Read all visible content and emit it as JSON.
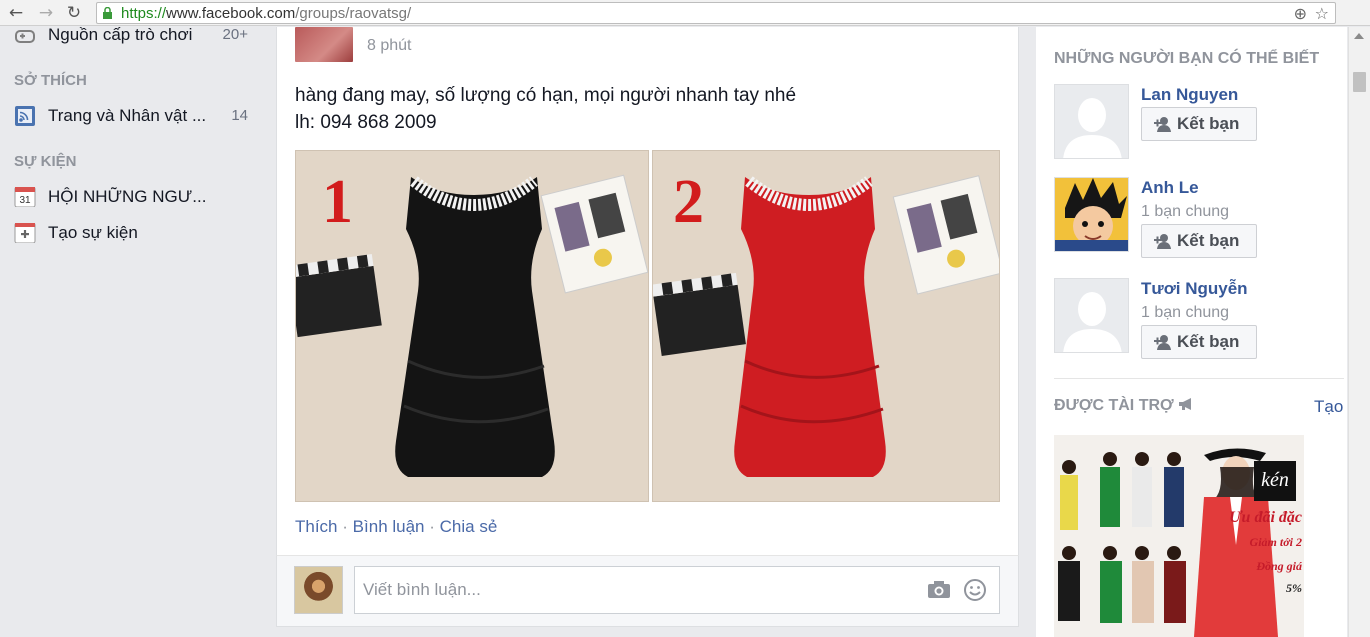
{
  "browser": {
    "url_scheme": "https://",
    "url_host": "www.facebook.com",
    "url_path": "/groups/raovatsg/",
    "icons": [
      "back-icon",
      "forward-icon",
      "reload-icon",
      "lock-icon",
      "zoom-icon",
      "star-icon"
    ]
  },
  "left_nav": {
    "top_item": {
      "label": "Nguồn cấp trò chơi",
      "count": "20+",
      "icon": "game-feed-icon"
    },
    "interests_heading": "SỞ THÍCH",
    "interests": [
      {
        "label": "Trang và Nhân vật ...",
        "count": "14",
        "icon": "rss-pages-icon"
      }
    ],
    "events_heading": "SỰ KIỆN",
    "events": [
      {
        "label": "HỘI NHỮNG NGƯ...",
        "icon": "calendar-icon",
        "calendar_day": "31"
      },
      {
        "label": "Tạo sự kiện",
        "icon": "create-event-icon"
      }
    ]
  },
  "post": {
    "time": "8 phút",
    "text_line1": "hàng đang may, số lượng có hạn, mọi người nhanh tay nhé",
    "text_line2": "lh: 094 868 2009",
    "photos": [
      {
        "label": "1",
        "dress_color": "#141414"
      },
      {
        "label": "2",
        "dress_color": "#cf1d22"
      }
    ],
    "actions": {
      "like": "Thích",
      "comment": "Bình luận",
      "share": "Chia sẻ",
      "separator": "·"
    }
  },
  "comment_box": {
    "placeholder": "Viết bình luận..."
  },
  "right": {
    "pymk_heading": "NHỮNG NGƯỜI BẠN CÓ THỂ BIẾT",
    "add_friend_label": "Kết bạn",
    "friends": [
      {
        "name": "Lan Nguyen",
        "mutual": ""
      },
      {
        "name": "Anh Le",
        "mutual": "1 bạn chung"
      },
      {
        "name": "Tươi Nguyễn",
        "mutual": "1 bạn chung"
      }
    ],
    "sponsored_heading": "ĐƯỢC TÀI TRỢ",
    "create_ad_link": "Tạo",
    "ad": {
      "brand": "kén",
      "text1": "Ưu đãi đặc",
      "text2": "Giảm tới 2",
      "text3": "Đồng giá",
      "text4": "5%"
    }
  },
  "colors": {
    "link": "#365899",
    "muted": "#90949c",
    "page_bg": "#e9eaed"
  }
}
